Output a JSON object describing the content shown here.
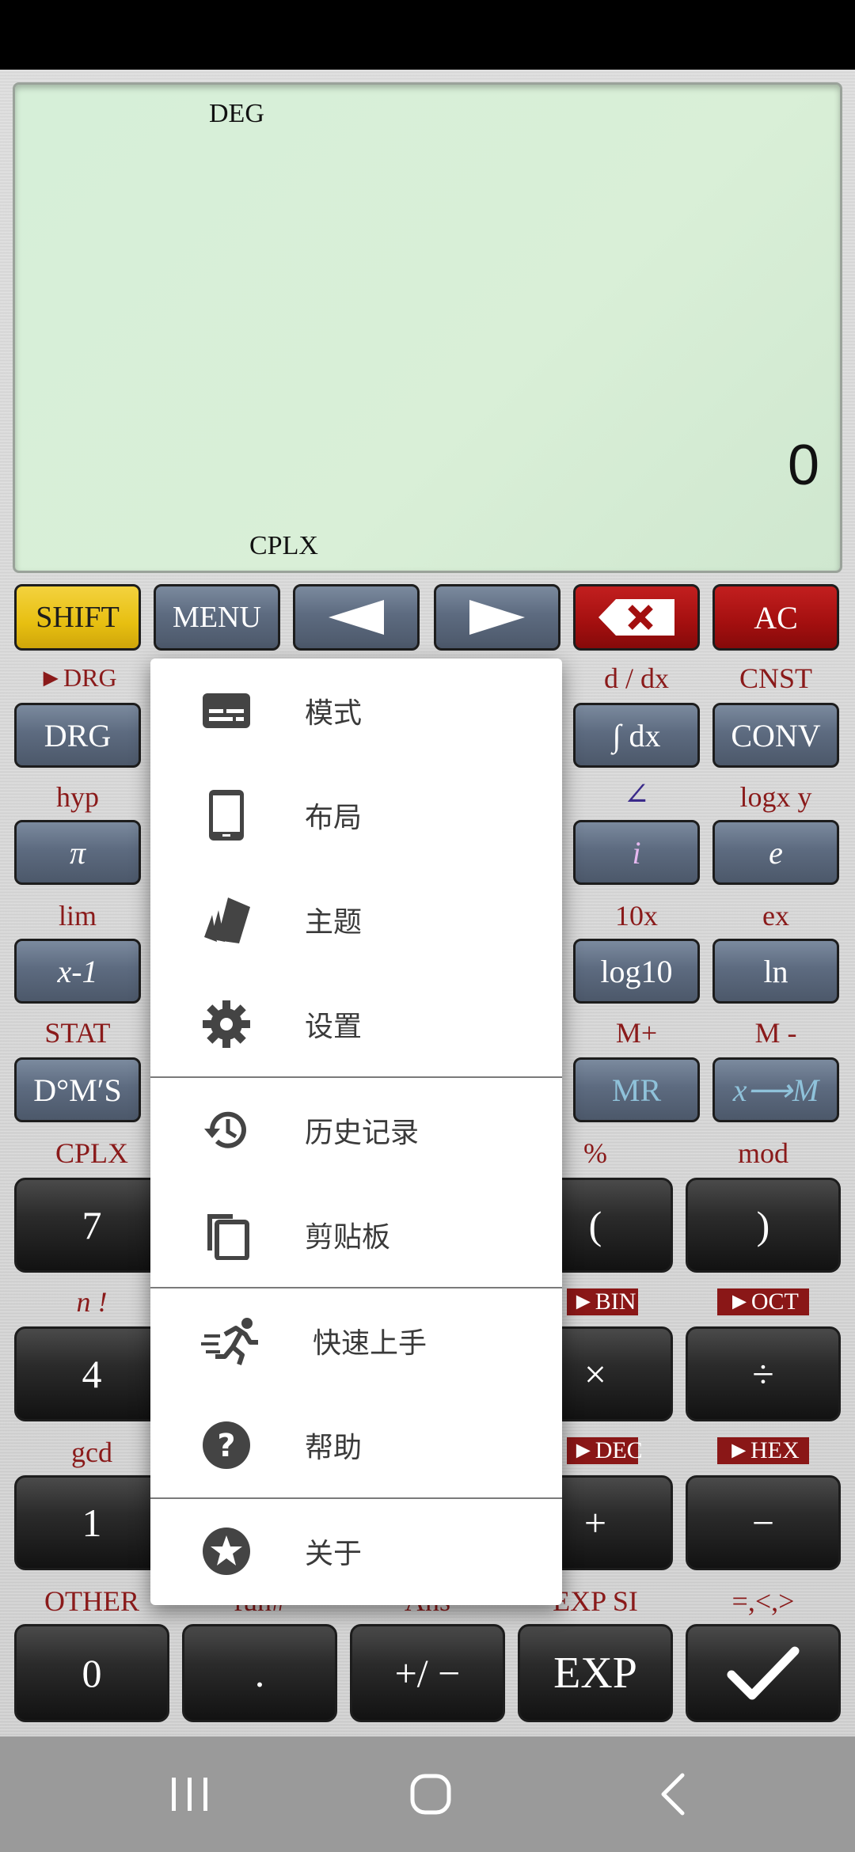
{
  "display": {
    "angle_mode": "DEG",
    "complex_indicator": "CPLX",
    "value": "0"
  },
  "top_row": {
    "shift": "SHIFT",
    "menu": "MENU",
    "left": "◀",
    "right": "▶",
    "ac": "AC"
  },
  "row2": {
    "drg_top": "►DRG",
    "drg": "DRG",
    "ddx_top": "d / dx",
    "integral": "∫ dx",
    "cnst_top": "CNST",
    "conv": "CONV"
  },
  "row3": {
    "hyp_top": "hyp",
    "pi": "π",
    "angle_top": "∠",
    "i": "i",
    "logxy_top": "logx y",
    "e": "e"
  },
  "row4": {
    "lim_top": "lim",
    "xinv": "x-1",
    "tenx_top": "10x",
    "log10": "log10",
    "ex_top": "ex",
    "ln": "ln"
  },
  "row5": {
    "stat_top": "STAT",
    "dms": "D°M′S",
    "mplus_top": "M+",
    "mr": "MR",
    "mminus_top": "M -",
    "xm": "x⟶M"
  },
  "row6": {
    "cplx_top": "CPLX",
    "seven": "7",
    "pct_top": "%",
    "lparen": "(",
    "mod_top": "mod",
    "rparen": ")"
  },
  "row7": {
    "fact_top": "n !",
    "four": "4",
    "bin_top": "►BIN",
    "mul": "×",
    "oct_top": "►OCT",
    "div": "÷"
  },
  "row8": {
    "gcd_top": "gcd",
    "one": "1",
    "dec_top": "►DEC",
    "plus": "+",
    "hex_top": "►HEX",
    "minus": "−"
  },
  "row9": {
    "other_top": "OTHER",
    "zero": "0",
    "dot_top": "fun#",
    "dot": ".",
    "ans_top": "Ans",
    "neg": "+/ −",
    "expsi_top": "EXP SI",
    "exp": "EXP",
    "cmp_top": "=,<,>"
  },
  "menu": {
    "items": [
      {
        "label": "模式",
        "icon": "mode-icon"
      },
      {
        "label": "布局",
        "icon": "tablet-icon"
      },
      {
        "label": "主题",
        "icon": "theme-icon"
      },
      {
        "label": "设置",
        "icon": "gear-icon"
      },
      {
        "label": "历史记录",
        "icon": "history-icon"
      },
      {
        "label": "剪贴板",
        "icon": "clipboard-icon"
      },
      {
        "label": "快速上手",
        "icon": "run-icon"
      },
      {
        "label": "帮助",
        "icon": "help-icon"
      },
      {
        "label": "关于",
        "icon": "star-icon"
      }
    ]
  },
  "colors": {
    "key_blue": "#5d6b80",
    "key_yellow": "#e7bf11",
    "key_red": "#a30f0f",
    "label_red": "#8a1a1a",
    "display_green": "#d6efd8"
  }
}
